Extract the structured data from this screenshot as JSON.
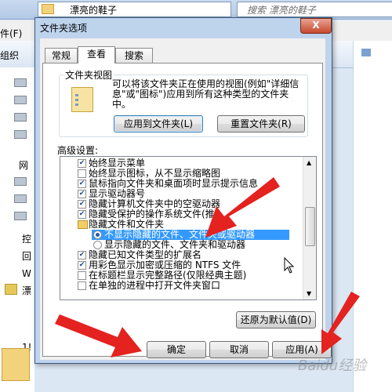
{
  "explorer": {
    "address_path": "漂亮的鞋子",
    "search_placeholder": "搜索 漂亮的鞋子",
    "menu_label": "件(F)",
    "organize_label": "组织",
    "nav_items": [
      "控",
      "回",
      "W",
      "漂",
      "1!"
    ],
    "nav_network": "网"
  },
  "dialog": {
    "title": "文件夹选项",
    "close_symbol": "X",
    "tabs": [
      {
        "label": "常规"
      },
      {
        "label": "查看"
      },
      {
        "label": "搜索"
      }
    ],
    "folder_views": {
      "group_label": "文件夹视图",
      "description": "可以将该文件夹正在使用的视图(例如\"详细信息\"或\"图标\")应用到所有这种类型的文件夹中。",
      "apply_button": "应用到文件夹(L)",
      "reset_button": "重置文件夹(R)"
    },
    "advanced": {
      "label": "高级设置:",
      "items": [
        {
          "text": "始终显示菜单",
          "kind": "checkbox",
          "checked": true
        },
        {
          "text": "始终显示图标，从不显示缩略图",
          "kind": "checkbox",
          "checked": false
        },
        {
          "text": "鼠标指向文件夹和桌面项时显示提示信息",
          "kind": "checkbox",
          "checked": true
        },
        {
          "text": "显示驱动器号",
          "kind": "checkbox",
          "checked": true
        },
        {
          "text": "隐藏计算机文件夹中的空驱动器",
          "kind": "checkbox",
          "checked": true
        },
        {
          "text": "隐藏受保护的操作系统文件(推",
          "kind": "checkbox",
          "checked": true
        },
        {
          "text": "隐藏文件和文件夹",
          "kind": "folder",
          "checked": false
        },
        {
          "text": "不显示隐藏的文件、文件夹或驱动器",
          "kind": "radio",
          "checked": true
        },
        {
          "text": "显示隐藏的文件、文件夹和驱动器",
          "kind": "radio",
          "checked": false
        },
        {
          "text": "隐藏已知文件类型的扩展名",
          "kind": "checkbox",
          "checked": true
        },
        {
          "text": "用彩色显示加密或压缩的 NTFS 文件",
          "kind": "checkbox",
          "checked": true
        },
        {
          "text": "在标题栏显示完整路径(仅限经典主题)",
          "kind": "checkbox",
          "checked": false
        },
        {
          "text": "在单独的进程中打开文件夹窗口",
          "kind": "checkbox",
          "checked": false
        }
      ],
      "restore_button": "还原为默认值(D)"
    },
    "buttons": {
      "ok": "确定",
      "cancel": "取消",
      "apply": "应用(A)"
    }
  },
  "watermark": "Baidu经验",
  "colors": {
    "annotation_arrow": "#e4221f",
    "selection": "#3399ff"
  }
}
